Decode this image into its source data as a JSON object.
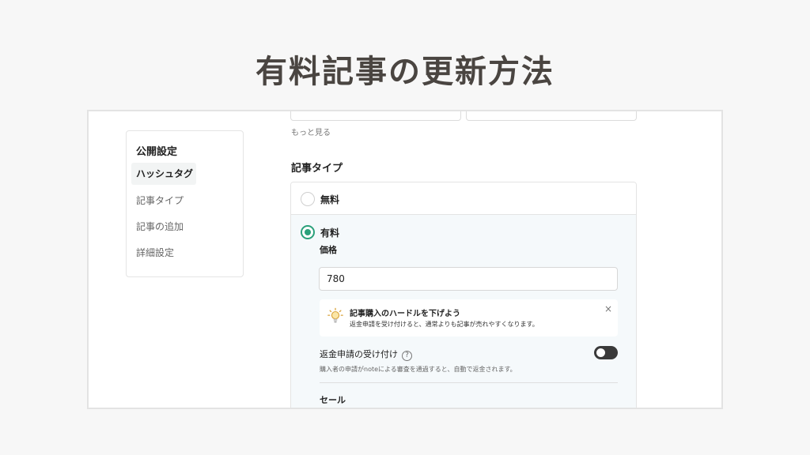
{
  "page_title": "有料記事の更新方法",
  "sidebar": {
    "heading": "公開設定",
    "items": [
      {
        "label": "ハッシュタグ",
        "active": true
      },
      {
        "label": "記事タイプ",
        "active": false
      },
      {
        "label": "記事の追加",
        "active": false
      },
      {
        "label": "詳細設定",
        "active": false
      }
    ]
  },
  "main": {
    "more_link": "もっと見る",
    "section_title": "記事タイプ",
    "options": {
      "free_label": "無料",
      "paid_label": "有料"
    },
    "price": {
      "label": "価格",
      "value": "780"
    },
    "tip": {
      "icon": "lightbulb-icon",
      "title": "記事購入のハードルを下げよう",
      "description": "返金申請を受け付けると、通常よりも記事が売れやすくなります。",
      "close": "×"
    },
    "refund": {
      "label": "返金申請の受け付け",
      "help": "?",
      "note": "購入者の申請がnoteによる審査を通過すると、自動で返金されます。"
    },
    "sale_title": "セール"
  },
  "colors": {
    "accent_green": "#2aa07a",
    "title_text": "#4a4541",
    "toggle_off": "#3a3a3a"
  }
}
